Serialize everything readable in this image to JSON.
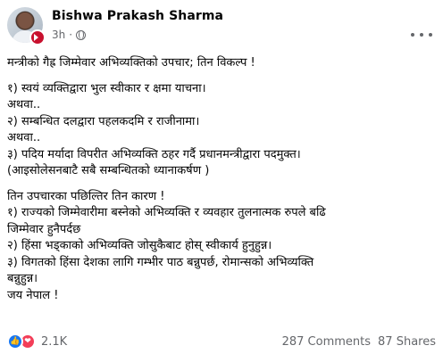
{
  "post": {
    "author": "Bishwa Prakash Sharma",
    "time": "3h",
    "dot": "·",
    "lines": [
      "मन्त्रीको गैह्र जिम्मेवार अभिव्यक्तिको उपचार; तिन विकल्प !",
      "१) स्वयं व्यक्तिद्वारा भुल स्वीकार र क्षमा याचना।",
      "अथवा..",
      "२) सम्बन्धित दलद्वारा पहलकदमि र राजीनामा।",
      "अथवा..",
      "३) पदिय मर्यादा विपरीत अभिव्यक्ति ठहर गर्दै प्रधानमन्त्रीद्वारा पदमुक्त।",
      "(आइसोलेसनबाटै सबै सम्बन्धितको ध्यानाकर्षण )",
      "तिन उपचारका पछिल्तिर तिन कारण !",
      "१) राज्यको जिम्मेवारीमा बस्नेको अभिव्यक्ति र व्यवहार तुलनात्मक रुपले बढि",
      "जिम्मेवार हुनैपर्दछ",
      "२) हिंसा भड्काको अभिव्यक्ति जोसुकैबाट होस् स्वीकार्य हुनुहुन्न।",
      "३) विगतको हिंसा देशका लागि गम्भीर पाठ बन्नुपर्छ, रोमान्सको अभिव्यक्ति",
      "बन्नुहुन्न।",
      "जय नेपाल !"
    ]
  },
  "reactions": {
    "count": "2.1K",
    "comments": "287 Comments",
    "shares": "87 Shares",
    "icons": [
      "like-icon",
      "love-icon"
    ],
    "like_color": "#1877f2",
    "love_color": "#f33e58"
  }
}
